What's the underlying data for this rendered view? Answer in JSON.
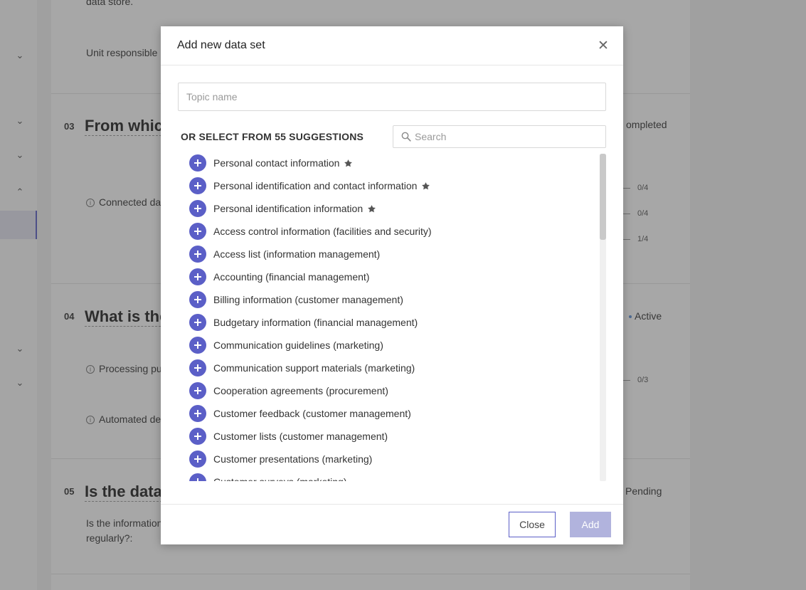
{
  "background": {
    "text_top": "data store.",
    "unit_responsible": "Unit responsible",
    "sections": [
      {
        "num": "03",
        "heading": "From which",
        "status": "ompleted"
      },
      {
        "num": "04",
        "heading": "What is the",
        "status": "Active"
      },
      {
        "num": "05",
        "heading": "Is the data",
        "status": "Pending"
      }
    ],
    "connected": "Connected da",
    "processing": "Processing pu",
    "automated": "Automated de",
    "info_text_1": "Is the information",
    "info_text_2": "regularly?:",
    "counters": [
      "0/4",
      "0/4",
      "1/4",
      "0/3"
    ]
  },
  "modal": {
    "title": "Add new data set",
    "topic_placeholder": "Topic name",
    "suggestions_label": "OR SELECT FROM 55 SUGGESTIONS",
    "search_placeholder": "Search",
    "items": [
      {
        "label": "Personal contact information",
        "starred": true
      },
      {
        "label": "Personal identification and contact information",
        "starred": true
      },
      {
        "label": "Personal identification information",
        "starred": true
      },
      {
        "label": "Access control information (facilities and security)",
        "starred": false
      },
      {
        "label": "Access list (information management)",
        "starred": false
      },
      {
        "label": "Accounting (financial management)",
        "starred": false
      },
      {
        "label": "Billing information (customer management)",
        "starred": false
      },
      {
        "label": "Budgetary information (financial management)",
        "starred": false
      },
      {
        "label": "Communication guidelines (marketing)",
        "starred": false
      },
      {
        "label": "Communication support materials (marketing)",
        "starred": false
      },
      {
        "label": "Cooperation agreements (procurement)",
        "starred": false
      },
      {
        "label": "Customer feedback (customer management)",
        "starred": false
      },
      {
        "label": "Customer lists (customer management)",
        "starred": false
      },
      {
        "label": "Customer presentations (marketing)",
        "starred": false
      },
      {
        "label": "Customer surveys (marketing)",
        "starred": false
      }
    ],
    "close_label": "Close",
    "add_label": "Add"
  },
  "colors": {
    "accent": "#5b5fc7",
    "add_disabled": "#b1b3dd"
  }
}
